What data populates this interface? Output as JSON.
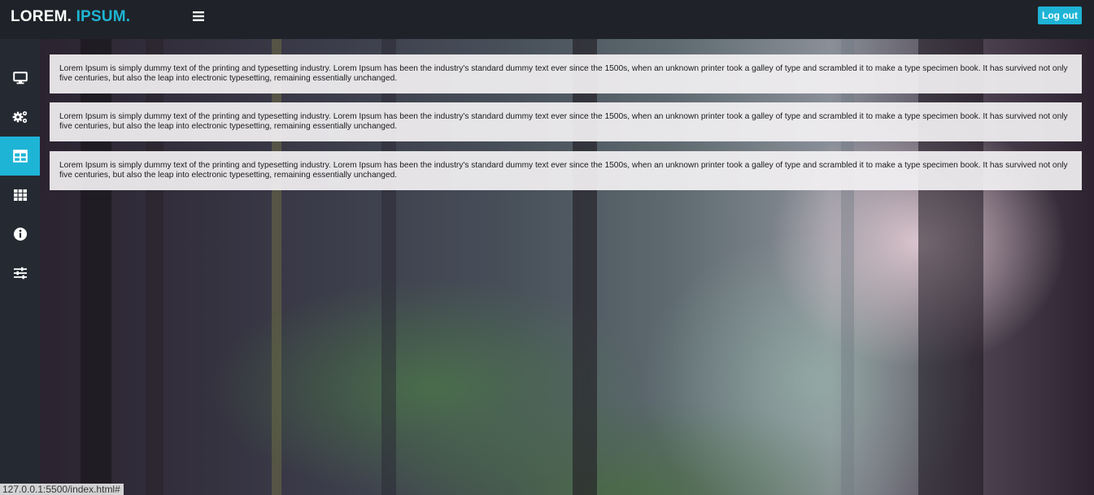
{
  "brand": {
    "part1": "LOREM.",
    "part2": "IPSUM."
  },
  "header": {
    "logout_label": "Log out"
  },
  "sidebar": {
    "items": [
      {
        "icon": "monitor-icon",
        "active": false
      },
      {
        "icon": "gears-icon",
        "active": false
      },
      {
        "icon": "table-icon",
        "active": true
      },
      {
        "icon": "grid-icon",
        "active": false
      },
      {
        "icon": "info-icon",
        "active": false
      },
      {
        "icon": "sliders-icon",
        "active": false
      }
    ]
  },
  "cards": [
    {
      "text": "Lorem Ipsum is simply dummy text of the printing and typesetting industry. Lorem Ipsum has been the industry's standard dummy text ever since the 1500s, when an unknown printer took a galley of type and scrambled it to make a type specimen book. It has survived not only five centuries, but also the leap into electronic typesetting, remaining essentially unchanged."
    },
    {
      "text": "Lorem Ipsum is simply dummy text of the printing and typesetting industry. Lorem Ipsum has been the industry's standard dummy text ever since the 1500s, when an unknown printer took a galley of type and scrambled it to make a type specimen book. It has survived not only five centuries, but also the leap into electronic typesetting, remaining essentially unchanged."
    },
    {
      "text": "Lorem Ipsum is simply dummy text of the printing and typesetting industry. Lorem Ipsum has been the industry's standard dummy text ever since the 1500s, when an unknown printer took a galley of type and scrambled it to make a type specimen book. It has survived not only five centuries, but also the leap into electronic typesetting, remaining essentially unchanged."
    }
  ],
  "status_bar": {
    "url": "127.0.0.1:5500/index.html#"
  },
  "colors": {
    "accent": "#1eb4d6",
    "topbar": "#1f2329",
    "sidebar": "#252a32"
  }
}
